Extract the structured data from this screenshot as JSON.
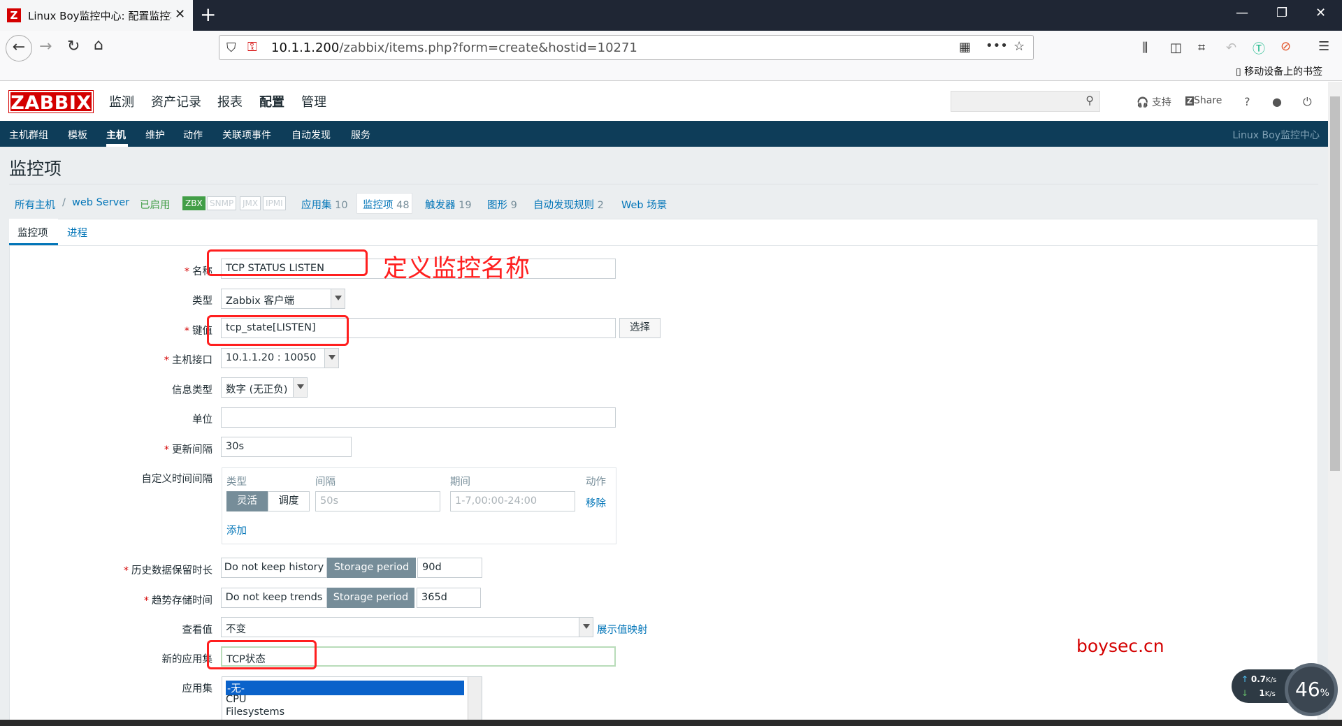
{
  "browser": {
    "tab_title": "Linux Boy监控中心: 配置监控项",
    "tab_close": "✕",
    "new_tab": "+",
    "url_host": "10.1.1.200",
    "url_path": "/zabbix/items.php?form=create&hostid=10271",
    "mobile_bookmarks": "移动设备上的书签",
    "window_controls": [
      "—",
      "❐",
      "✕"
    ],
    "icons": [
      "back-icon",
      "forward-icon",
      "reload-icon",
      "home-icon",
      "shield-icon",
      "insecure-lock-icon",
      "qr-icon",
      "more-icon",
      "bookmark-star-icon",
      "library-icon",
      "sidebar-icon",
      "crop-icon",
      "undo-icon",
      "translate-icon",
      "block-icon",
      "menu-icon"
    ]
  },
  "zabbix": {
    "logo": "ZABBIX",
    "top_menu": [
      "监测",
      "资产记录",
      "报表",
      "配置",
      "管理"
    ],
    "header_right": {
      "support": "支持",
      "share": "Share",
      "help": "?"
    },
    "sub_menu": [
      "主机群组",
      "模板",
      "主机",
      "维护",
      "动作",
      "关联项事件",
      "自动发现",
      "服务"
    ],
    "sub_brand": "Linux Boy监控中心",
    "page_title": "监控项",
    "breadcrumb": {
      "all_hosts": "所有主机",
      "sep": "/",
      "host": "web Server",
      "status": "已启用",
      "zbx": "ZBX",
      "snmp": "SNMP",
      "jmx": "JMX",
      "ipmi": "IPMI",
      "apps": "应用集",
      "apps_count": "10",
      "items": "监控项",
      "items_count": "48",
      "triggers": "触发器",
      "triggers_count": "19",
      "graphs": "图形",
      "graphs_count": "9",
      "discovery": "自动发现规则",
      "discovery_count": "2",
      "web": "Web 场景"
    },
    "tabs": [
      "监控项",
      "进程"
    ],
    "form": {
      "name_label": "名称",
      "name_value": "TCP STATUS LISTEN",
      "type_label": "类型",
      "type_value": "Zabbix 客户端",
      "key_label": "键值",
      "key_value": "tcp_state[LISTEN]",
      "key_select": "选择",
      "iface_label": "主机接口",
      "iface_value": "10.1.1.20 : 10050",
      "info_label": "信息类型",
      "info_value": "数字 (无正负)",
      "unit_label": "单位",
      "unit_value": "",
      "interval_label": "更新间隔",
      "interval_value": "30s",
      "custom_label": "自定义时间间隔",
      "custom_headers": [
        "类型",
        "间隔",
        "期间",
        "动作"
      ],
      "custom_flex": "灵活",
      "custom_sched": "调度",
      "custom_interval_ph": "50s",
      "custom_period_ph": "1-7,00:00-24:00",
      "custom_remove": "移除",
      "custom_add": "添加",
      "history_label": "历史数据保留时长",
      "history_nokeep": "Do not keep history",
      "history_storage": "Storage period",
      "history_value": "90d",
      "trends_label": "趋势存储时间",
      "trends_nokeep": "Do not keep trends",
      "trends_storage": "Storage period",
      "trends_value": "365d",
      "valuemap_label": "查看值",
      "valuemap_value": "不变",
      "valuemap_link": "展示值映射",
      "newapp_label": "新的应用集",
      "newapp_value": "TCP状态",
      "apps_label": "应用集",
      "apps_options": [
        "-无-",
        "CPU",
        "Filesystems"
      ]
    }
  },
  "annotation": "定义监控名称",
  "watermark": "boysec.cn",
  "speed_widget": {
    "up": "0.7",
    "up_unit": "K/s",
    "down": "1",
    "down_unit": "K/s",
    "percent": "46",
    "percent_unit": "%"
  },
  "colors": {
    "zabbix_red": "#d40000",
    "nav_blue": "#0e3d59",
    "link_blue": "#0275b8",
    "annotation_red": "#ff1f1f",
    "enabled_green": "#429e47"
  }
}
